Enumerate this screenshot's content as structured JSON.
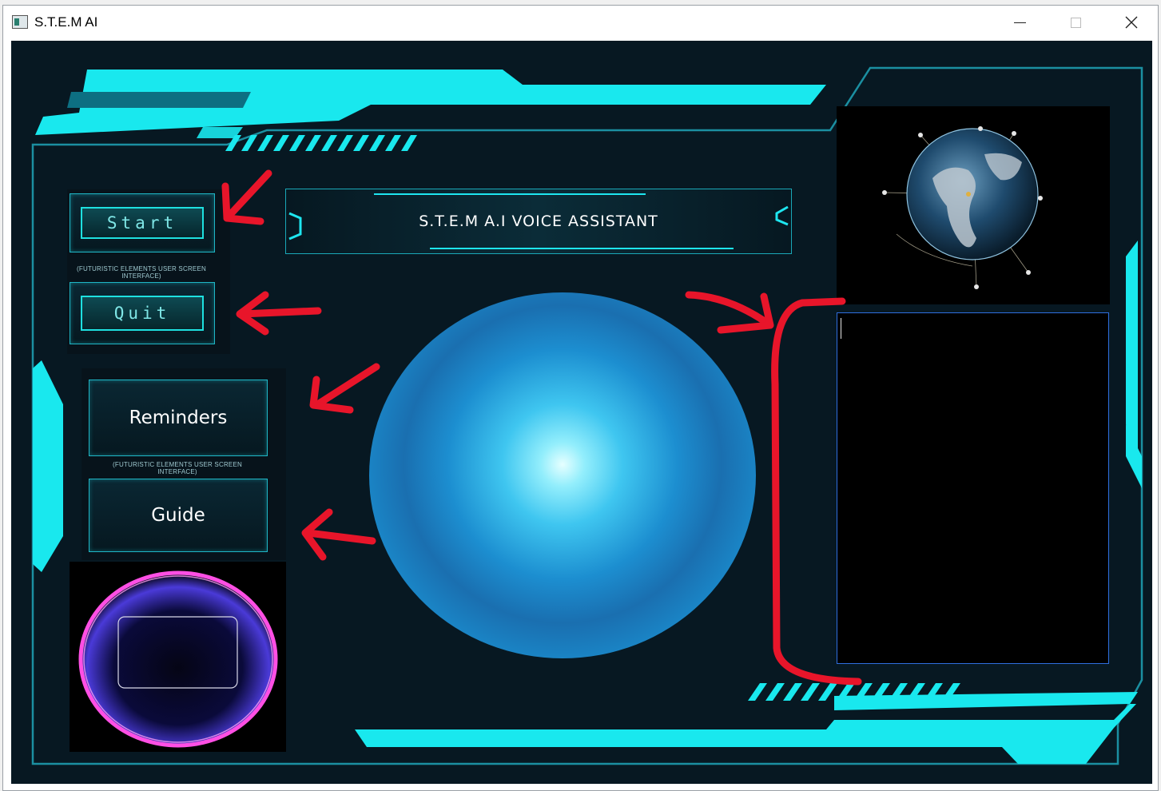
{
  "window": {
    "title": "S.T.E.M AI",
    "controls": {
      "minimize": "minimize-icon",
      "maximize": "maximize-icon",
      "close": "close-icon"
    }
  },
  "left_panel": {
    "start_label": "Start",
    "quit_label": "Quit",
    "reminders_label": "Reminders",
    "guide_label": "Guide",
    "caption_top": "(FUTURISTIC ELEMENTS USER SCREEN INTERFACE)",
    "caption_bottom": "(FUTURISTIC ELEMENTS USER SCREEN INTERFACE)"
  },
  "header": {
    "title": "S.T.E.M  A.I  VOICE ASSISTANT"
  },
  "colors": {
    "accent": "#1ee6f0",
    "annotation": "#e8152a",
    "background": "#071822",
    "textbox_border": "#2f6fe0"
  },
  "text_output": {
    "value": ""
  }
}
